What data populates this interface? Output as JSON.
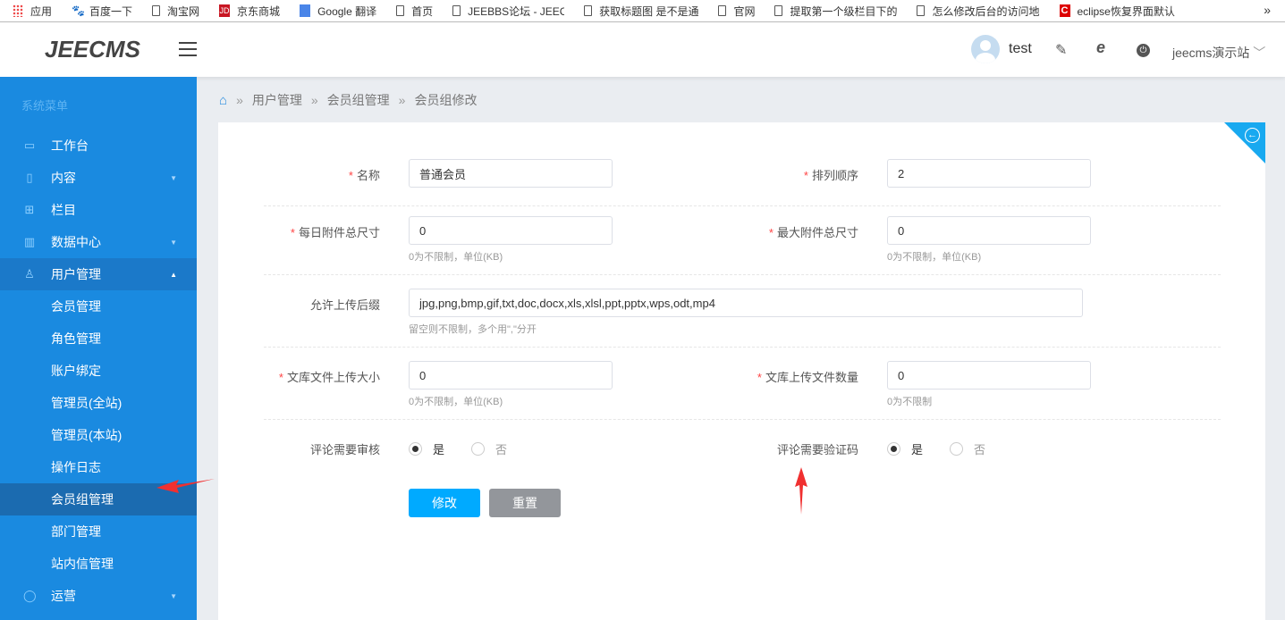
{
  "bookmarks": {
    "items": [
      "应用",
      "百度一下",
      "淘宝网",
      "京东商城",
      "Google 翻译",
      "首页",
      "JEEBBS论坛 - JEECMS",
      "获取标题图 是不是通",
      "官网",
      "提取第一个级栏目下的",
      "怎么修改后台的访问地",
      "eclipse恢复界面默认"
    ],
    "more": "»"
  },
  "header": {
    "logo": "JEECMS",
    "username": "test",
    "site": "jeecms演示站"
  },
  "sidebar": {
    "title": "系统菜单",
    "items": [
      {
        "label": "工作台",
        "icon": "monitor-icon"
      },
      {
        "label": "内容",
        "icon": "file-icon"
      },
      {
        "label": "栏目",
        "icon": "grid-icon"
      },
      {
        "label": "数据中心",
        "icon": "bar-chart-icon"
      },
      {
        "label": "用户管理",
        "icon": "user-icon"
      },
      {
        "label": "运营",
        "icon": "shield-icon"
      }
    ],
    "subitems": [
      "会员管理",
      "角色管理",
      "账户绑定",
      "管理员(全站)",
      "管理员(本站)",
      "操作日志",
      "会员组管理",
      "部门管理",
      "站内信管理"
    ],
    "active": "会员组管理"
  },
  "breadcrumb": [
    "用户管理",
    "会员组管理",
    "会员组修改"
  ],
  "form": {
    "name": {
      "label": "名称",
      "value": "普通会员"
    },
    "order": {
      "label": "排列顺序",
      "value": "2"
    },
    "daily_size": {
      "label": "每日附件总尺寸",
      "value": "0",
      "hint": "0为不限制，单位(KB)"
    },
    "max_size": {
      "label": "最大附件总尺寸",
      "value": "0",
      "hint": "0为不限制，单位(KB)"
    },
    "suffix": {
      "label": "允许上传后缀",
      "value": "jpg,png,bmp,gif,txt,doc,docx,xls,xlsl,ppt,pptx,wps,odt,mp4",
      "hint": "留空则不限制，多个用\",\"分开"
    },
    "lib_size": {
      "label": "文库文件上传大小",
      "value": "0",
      "hint": "0为不限制，单位(KB)"
    },
    "lib_count": {
      "label": "文库上传文件数量",
      "value": "0",
      "hint": "0为不限制"
    },
    "comment_review": {
      "label": "评论需要审核",
      "yes": "是",
      "no": "否",
      "selected": "是"
    },
    "comment_captcha": {
      "label": "评论需要验证码",
      "yes": "是",
      "no": "否",
      "selected": "是"
    },
    "submit": "修改",
    "reset": "重置"
  },
  "colors": {
    "sidebar": "#1a8ae0",
    "primary": "#00aaff",
    "annotation": "#f03030"
  }
}
